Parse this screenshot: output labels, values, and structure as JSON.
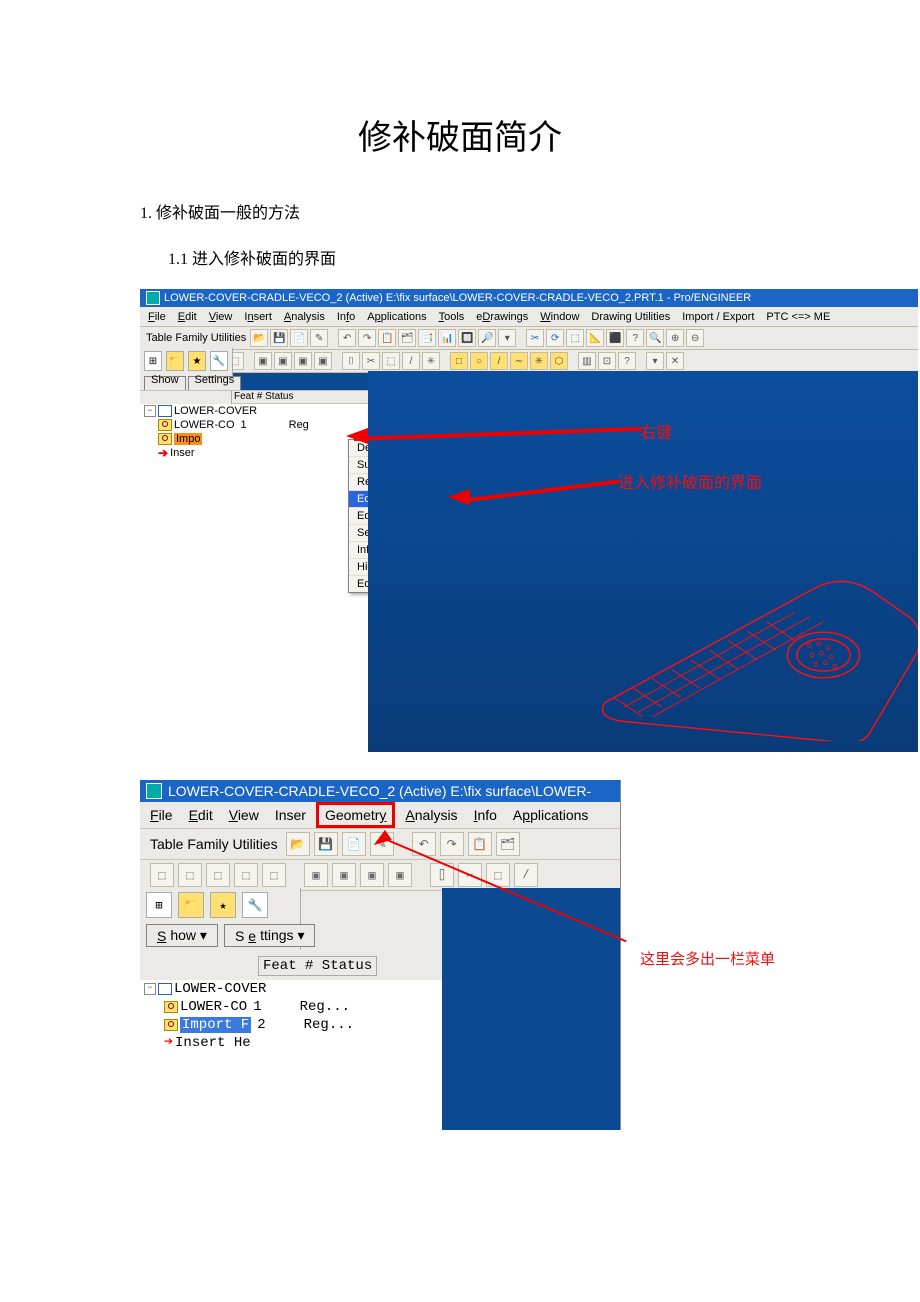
{
  "doc": {
    "title": "修补破面简介",
    "section1": "1.   修补破面一般的方法",
    "section11": "1.1  进入修补破面的界面"
  },
  "shot1": {
    "window_title": "LOWER-COVER-CRADLE-VECO_2 (Active) E:\\fix surface\\LOWER-COVER-CRADLE-VECO_2.PRT.1 - Pro/ENGINEER",
    "menus": [
      "File",
      "Edit",
      "View",
      "Insert",
      "Analysis",
      "Info",
      "Applications",
      "Tools",
      "eDrawings",
      "Window",
      "Drawing Utilities",
      "Import / Export",
      "PTC <=> ME"
    ],
    "utilities_label": "Table Family Utilities",
    "show_btn": "Show ▾",
    "settings_btn": "Settings ▾",
    "tree_header": "Feat # Status",
    "tree": {
      "root": "LOWER-COVER",
      "child1": "LOWER-CO",
      "child1_num": "1",
      "child1_status": "Reg",
      "child2_sel": "Impo",
      "child3": "Inser"
    },
    "context_menu": {
      "delete": "Delete",
      "suppress": "Suppress",
      "rename": "Rename",
      "edit_def": "Edit Definition",
      "edit_refs": "Edit References",
      "setup_note": "Setup Note",
      "info": "Info",
      "hide": "Hide",
      "edit_params": "Edit Parameters"
    },
    "overlay_right_click": "右键",
    "overlay_enter_ui": "进入修补破面的界面"
  },
  "shot2": {
    "window_title": "LOWER-COVER-CRADLE-VECO_2 (Active) E:\\fix surface\\LOWER-",
    "menus": {
      "file": "File",
      "edit": "Edit",
      "view": "View",
      "insert": "Inser",
      "geometry": "Geometry",
      "analysis": "Analysis",
      "info": "Info",
      "applications": "Applications"
    },
    "utilities_label": "Table Family Utilities",
    "show_btn": "Show ▾",
    "settings_btn": "Settings ▾",
    "tree_header": "Feat # Status",
    "tree": {
      "root": "LOWER-COVER",
      "r1_label": "LOWER-CO",
      "r1_num": "1",
      "r1_status": "Reg...",
      "r2_label_sel": "Import F",
      "r2_num": "2",
      "r2_status": "Reg...",
      "r3_label": "Insert He"
    },
    "overlay_extra_menu": "这里会多出一栏菜单"
  }
}
